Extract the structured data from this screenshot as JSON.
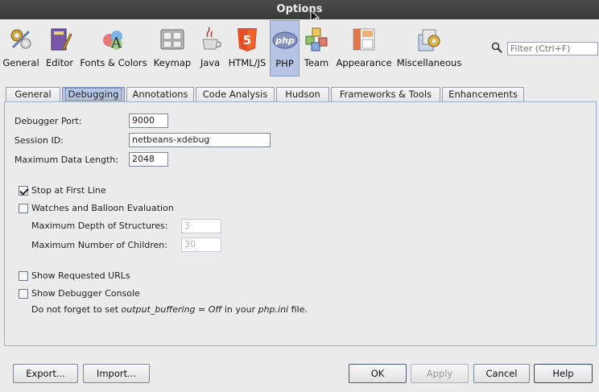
{
  "window": {
    "title": "Options"
  },
  "categories": [
    {
      "label": "General",
      "icon": "general-gears-icon"
    },
    {
      "label": "Editor",
      "icon": "editor-icon"
    },
    {
      "label": "Fonts & Colors",
      "icon": "fonts-colors-icon"
    },
    {
      "label": "Keymap",
      "icon": "keymap-icon"
    },
    {
      "label": "Java",
      "icon": "java-icon"
    },
    {
      "label": "HTML/JS",
      "icon": "html5-icon"
    },
    {
      "label": "PHP",
      "icon": "php-icon",
      "selected": true
    },
    {
      "label": "Team",
      "icon": "team-icon"
    },
    {
      "label": "Appearance",
      "icon": "appearance-icon"
    },
    {
      "label": "Miscellaneous",
      "icon": "miscellaneous-icon"
    }
  ],
  "search": {
    "placeholder": "Filter (Ctrl+F)"
  },
  "tabs": [
    {
      "label": "General"
    },
    {
      "label": "Debugging",
      "selected": true
    },
    {
      "label": "Annotations"
    },
    {
      "label": "Code Analysis"
    },
    {
      "label": "Hudson"
    },
    {
      "label": "Frameworks & Tools"
    },
    {
      "label": "Enhancements"
    }
  ],
  "debugging": {
    "port_label": "Debugger Port:",
    "port_value": "9000",
    "session_label": "Session ID:",
    "session_value": "netbeans-xdebug",
    "maxlen_label": "Maximum Data Length:",
    "maxlen_value": "2048",
    "stop_first_line": {
      "label": "Stop at First Line",
      "checked": true
    },
    "watches": {
      "label": "Watches and Balloon Evaluation",
      "checked": false
    },
    "max_depth_label": "Maximum Depth of Structures:",
    "max_depth_value": "3",
    "max_children_label": "Maximum Number of Children:",
    "max_children_value": "30",
    "show_urls": {
      "label": "Show Requested URLs",
      "checked": false
    },
    "show_console": {
      "label": "Show Debugger Console",
      "checked": false
    },
    "note_prefix": "Do not forget to set ",
    "note_setting": "output_buffering = Off",
    "note_mid": " in your ",
    "note_file": "php.ini",
    "note_suffix": " file."
  },
  "buttons": {
    "export": "Export...",
    "import": "Import...",
    "ok": "OK",
    "apply": "Apply",
    "cancel": "Cancel",
    "help": "Help"
  }
}
